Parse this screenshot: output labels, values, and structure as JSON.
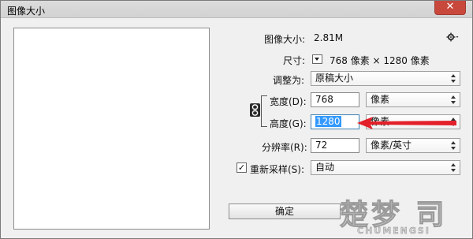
{
  "window": {
    "title": "图像大小",
    "close_glyph": "✕"
  },
  "info": {
    "image_size_label": "图像大小:",
    "image_size_value": "2.81M",
    "dimensions_label": "尺寸:",
    "dimensions_value": "768 像素 × 1280 像素"
  },
  "fit": {
    "label": "调整为:",
    "value": "原稿大小"
  },
  "width": {
    "label": "宽度(D):",
    "value": "768",
    "unit": "像素"
  },
  "height": {
    "label": "高度(G):",
    "value": "1280",
    "unit": "像素"
  },
  "resolution": {
    "label": "分辨率(R):",
    "value": "72",
    "unit": "像素/英寸"
  },
  "resample": {
    "label": "重新采样(S):",
    "checked_glyph": "✓",
    "value": "自动"
  },
  "buttons": {
    "ok": "确定"
  },
  "watermark": {
    "text": "楚梦 司",
    "subtext": "CHUMENGSI"
  },
  "colors": {
    "arrow": "#e3202a",
    "selection": "#3399ff"
  },
  "icons": [
    "gear-icon",
    "dropdown-icon",
    "link-chain-icon",
    "close-icon",
    "annotation-arrow"
  ]
}
